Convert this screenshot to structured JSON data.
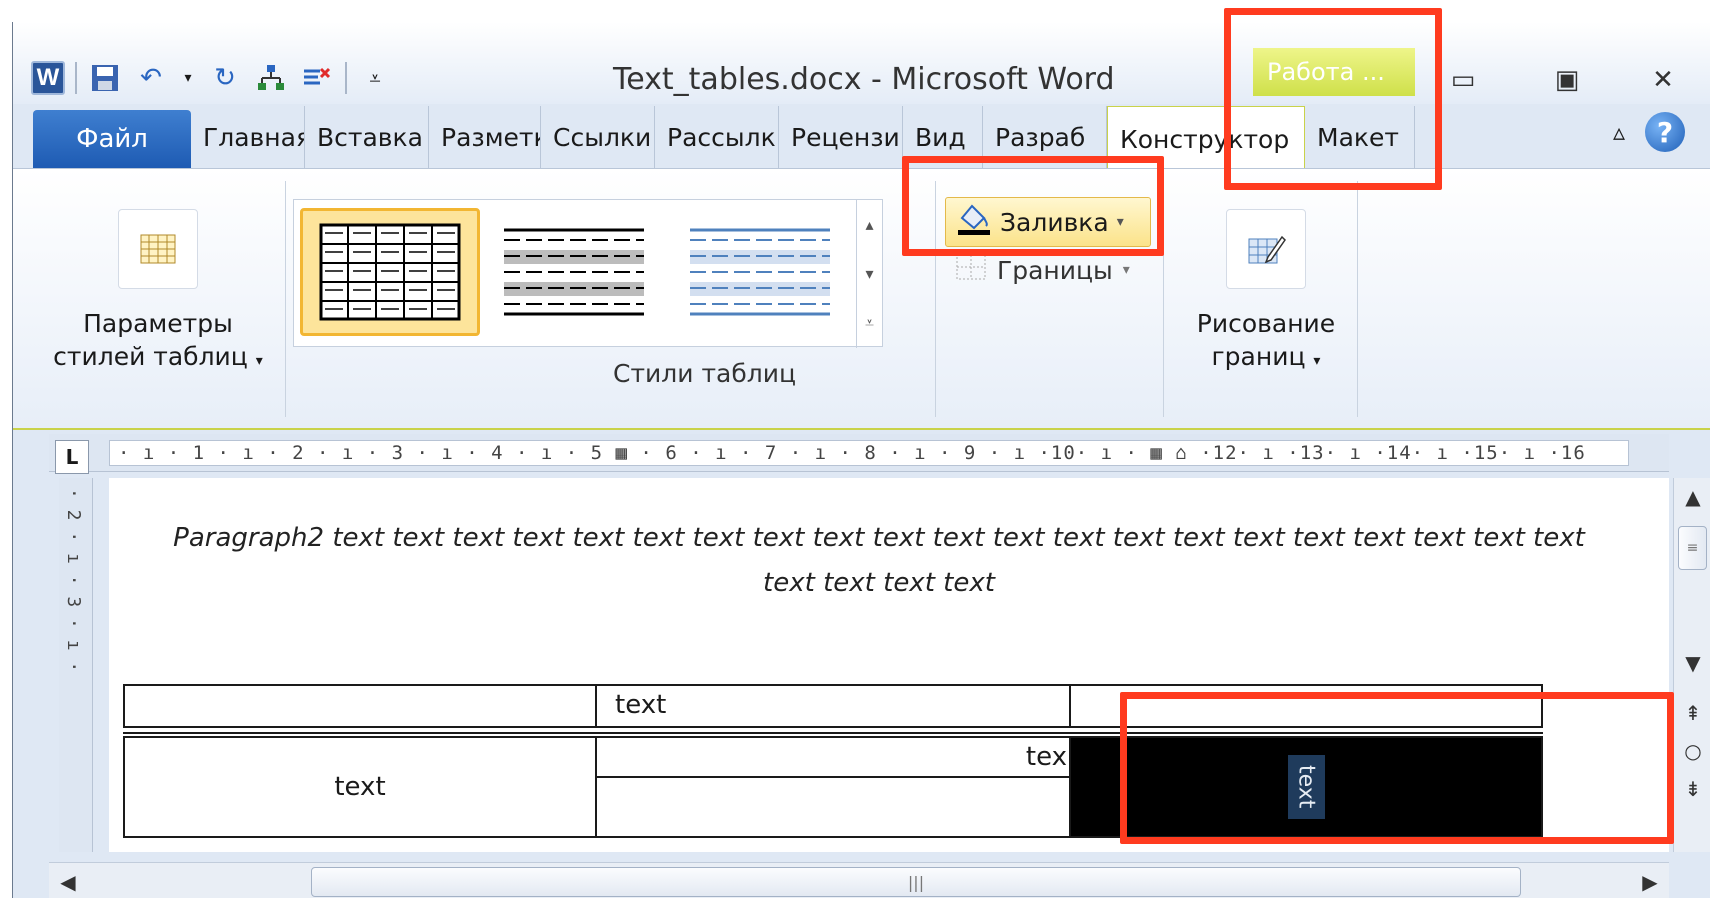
{
  "window": {
    "title": "Text_tables.docx - Microsoft Word",
    "app_icon": "W",
    "contextual_tab": "Работа ...",
    "controls": {
      "minimize": "▭",
      "restore": "▣",
      "close": "✕"
    }
  },
  "quick_access": [
    "save-icon",
    "undo-icon",
    "redo-icon",
    "structure-icon",
    "delete-format-icon",
    "customize-icon"
  ],
  "tabs": [
    {
      "label": "Файл"
    },
    {
      "label": "Главная"
    },
    {
      "label": "Вставка"
    },
    {
      "label": "Разметк"
    },
    {
      "label": "Ссылки"
    },
    {
      "label": "Рассылк"
    },
    {
      "label": "Рецензи"
    },
    {
      "label": "Вид"
    },
    {
      "label": "Разраб"
    },
    {
      "label": "Конструктор"
    },
    {
      "label": "Макет"
    }
  ],
  "ribbon": {
    "params": {
      "line1": "Параметры",
      "line2": "стилей таблиц"
    },
    "styles_group_label": "Стили таблиц",
    "shading_label": "Заливка",
    "borders_label": "Границы",
    "draw": {
      "line1": "Рисование",
      "line2": "границ"
    }
  },
  "ruler": {
    "marks": "· ı · 1 · ı · 2 · ı · 3 · ı · 4 · ı · 5 ▦ · 6 · ı · 7 · ı · 8 · ı · 9 · ı ·10· ı · ▦ ⌂ ·12· ı ·13· ı ·14· ı ·15· ı ·16",
    "vertical": "· 2 · ı · 3 · ı ·"
  },
  "document": {
    "paragraph": "Paragraph2 text text text text text text text text text text text text text text text text text text text text text text text text text",
    "table": {
      "r1c2": "text",
      "r2c1": "text",
      "r2c2": "tex",
      "shaded_cell": "text"
    }
  },
  "colors": {
    "highlight": "#ff3b1f",
    "file_tab": "#2a66c1",
    "shaded_cell_bg": "#000000",
    "shaded_cell_text_bg": "#1f3b5c"
  }
}
